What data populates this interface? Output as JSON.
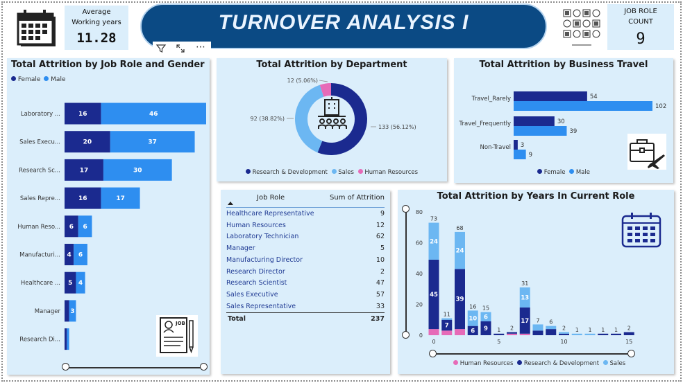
{
  "header": {
    "title": "TURNOVER ANALYSIS I",
    "kpi_avg_years": {
      "label_line1": "Average",
      "label_line2": "Working years",
      "value": "11.28"
    },
    "kpi_role_count": {
      "label_line1": "JOB ROLE",
      "label_line2": "COUNT",
      "value": "9"
    },
    "visual_toolbar": {
      "filter_icon": "filter-icon",
      "focus_icon": "focus-mode-icon",
      "more_icon": "more-options-icon"
    }
  },
  "colors": {
    "dark_blue": "#1b2a8f",
    "light_blue": "#2e8ef0",
    "sky": "#6cb7f2",
    "pink": "#e66bb8",
    "title_pill": "#0b4a84",
    "card_bg": "#dbeefb"
  },
  "job_role_gender": {
    "title": "Total Attrition by Job Role and Gender",
    "legend": [
      "Female",
      "Male"
    ],
    "chart_data": {
      "type": "bar",
      "orientation": "horizontal-stacked",
      "categories": [
        "Laboratory ...",
        "Sales Execu...",
        "Research Sc...",
        "Sales Repre...",
        "Human Reso...",
        "Manufacturi...",
        "Healthcare ...",
        "Manager",
        "Research Di..."
      ],
      "series": [
        {
          "name": "Female",
          "values": [
            16,
            20,
            17,
            16,
            6,
            4,
            5,
            2,
            1
          ],
          "labels": [
            "16",
            "20",
            "17",
            "16",
            "6",
            "4",
            "5",
            "",
            ""
          ]
        },
        {
          "name": "Male",
          "values": [
            46,
            37,
            30,
            17,
            6,
            6,
            4,
            3,
            1
          ],
          "labels": [
            "46",
            "37",
            "30",
            "17",
            "6",
            "6",
            "4",
            "3",
            ""
          ]
        }
      ]
    }
  },
  "department": {
    "title": "Total Attrition by Department",
    "chart_data": {
      "type": "pie",
      "donut": true,
      "slices": [
        {
          "name": "Research & Development",
          "value": 133,
          "label": "133 (56.12%)"
        },
        {
          "name": "Sales",
          "value": 92,
          "label": "92 (38.82%)"
        },
        {
          "name": "Human Resources",
          "value": 12,
          "label": "12 (5.06%)"
        }
      ]
    },
    "legend": [
      "Research & Development",
      "Sales",
      "Human Resources"
    ]
  },
  "business_travel": {
    "title": "Total Attrition by Business Travel",
    "legend": [
      "Female",
      "Male"
    ],
    "chart_data": {
      "type": "bar",
      "orientation": "horizontal-grouped",
      "categories": [
        "Travel_Rarely",
        "Travel_Frequently",
        "Non-Travel"
      ],
      "series": [
        {
          "name": "Female",
          "values": [
            54,
            30,
            3
          ]
        },
        {
          "name": "Male",
          "values": [
            102,
            39,
            9
          ]
        }
      ]
    }
  },
  "table": {
    "col1": "Job Role",
    "col2": "Sum of Attrition",
    "rows": [
      {
        "role": "Healthcare Representative",
        "value": "9"
      },
      {
        "role": "Human Resources",
        "value": "12"
      },
      {
        "role": "Laboratory Technician",
        "value": "62"
      },
      {
        "role": "Manager",
        "value": "5"
      },
      {
        "role": "Manufacturing Director",
        "value": "10"
      },
      {
        "role": "Research Director",
        "value": "2"
      },
      {
        "role": "Research Scientist",
        "value": "47"
      },
      {
        "role": "Sales Executive",
        "value": "57"
      },
      {
        "role": "Sales Representative",
        "value": "33"
      }
    ],
    "total_label": "Total",
    "total_value": "237"
  },
  "years_role": {
    "title": "Total Attrition by Years In Current Role",
    "legend": [
      "Human Resources",
      "Research & Development",
      "Sales"
    ],
    "chart_data": {
      "type": "bar",
      "orientation": "vertical-stacked",
      "x": [
        0,
        1,
        2,
        3,
        4,
        5,
        6,
        7,
        8,
        9,
        10,
        11,
        12,
        13,
        14,
        15
      ],
      "xticks": [
        "0",
        "5",
        "10",
        "15"
      ],
      "yticks": [
        "0",
        "20",
        "40",
        "60",
        "80"
      ],
      "ylim": [
        0,
        80
      ],
      "series": [
        {
          "name": "Human Resources",
          "values": [
            4,
            3,
            4,
            0,
            0,
            0,
            1,
            1,
            0,
            0,
            0,
            0,
            0,
            0,
            0,
            0
          ]
        },
        {
          "name": "Research & Development",
          "values": [
            45,
            7,
            39,
            6,
            9,
            1,
            1,
            17,
            3,
            4,
            1,
            0,
            0,
            1,
            1,
            2
          ]
        },
        {
          "name": "Sales",
          "values": [
            24,
            1,
            24,
            10,
            6,
            0,
            0,
            13,
            4,
            2,
            1,
            1,
            1,
            0,
            0,
            0
          ]
        }
      ],
      "totals": [
        73,
        11,
        68,
        16,
        15,
        1,
        2,
        31,
        7,
        6,
        2,
        1,
        1,
        1,
        1,
        2
      ],
      "segment_labels": {
        "Research & Development": [
          "45",
          "7",
          "39",
          "6",
          "9",
          "",
          "",
          "17",
          "",
          "",
          "",
          "",
          "",
          "",
          "",
          ""
        ],
        "Sales": [
          "24",
          "",
          "24",
          "10",
          "6",
          "",
          "",
          "13",
          "",
          "",
          "",
          "",
          "",
          "",
          "",
          ""
        ]
      }
    }
  }
}
